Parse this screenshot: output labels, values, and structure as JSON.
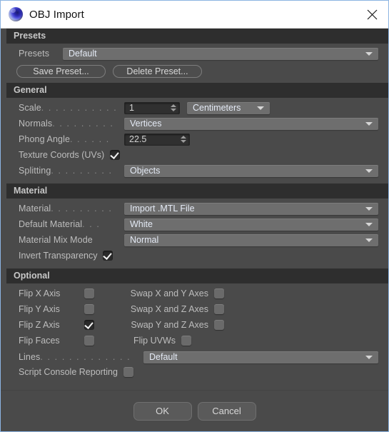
{
  "window": {
    "title": "OBJ Import",
    "app_icon": "cinema4d-sphere-icon",
    "close_icon": "close-icon",
    "border_color": "#8cb4e2",
    "panel_bg": "#4a4a4a",
    "section_header_bg": "#2e2e2e",
    "dropdown_bg": "#6e6e6e"
  },
  "sections": {
    "presets": {
      "title": "Presets",
      "preset_label": "Presets",
      "preset_value": "Default",
      "save_button": "Save Preset...",
      "delete_button": "Delete Preset..."
    },
    "general": {
      "title": "General",
      "scale_label": "Scale",
      "scale_value": "1",
      "scale_units": "Centimeters",
      "normals_label": "Normals",
      "normals_value": "Vertices",
      "phong_label": "Phong Angle",
      "phong_value": "22.5",
      "texture_coords_label": "Texture Coords (UVs)",
      "texture_coords_checked": "checked",
      "splitting_label": "Splitting",
      "splitting_value": "Objects"
    },
    "material": {
      "title": "Material",
      "material_label": "Material",
      "material_value": "Import .MTL File",
      "default_material_label": "Default Material",
      "default_material_value": "White",
      "mix_mode_label": "Material Mix Mode",
      "mix_mode_value": "Normal",
      "invert_transparency_label": "Invert Transparency",
      "invert_transparency_checked": "checked"
    },
    "optional": {
      "title": "Optional",
      "flip_x_label": "Flip X Axis",
      "flip_y_label": "Flip Y Axis",
      "flip_z_label": "Flip Z Axis",
      "flip_faces_label": "Flip Faces",
      "swap_xy_label": "Swap X and Y Axes",
      "swap_xz_label": "Swap X and Z Axes",
      "swap_yz_label": "Swap Y and Z Axes",
      "flip_uvws_label": "Flip UVWs",
      "lines_label": "Lines",
      "lines_value": "Default",
      "script_console_label": "Script Console Reporting"
    }
  },
  "footer": {
    "ok_label": "OK",
    "cancel_label": "Cancel"
  },
  "leaders": {
    "d14": ". . . . . . . . . . . . .",
    "d12": ". . . . . . . . . . .",
    "d10": ". . . . . . . . .",
    "d9": ". . . . . . . .",
    "d7": ". . . . . .",
    "d3": ". . ."
  }
}
